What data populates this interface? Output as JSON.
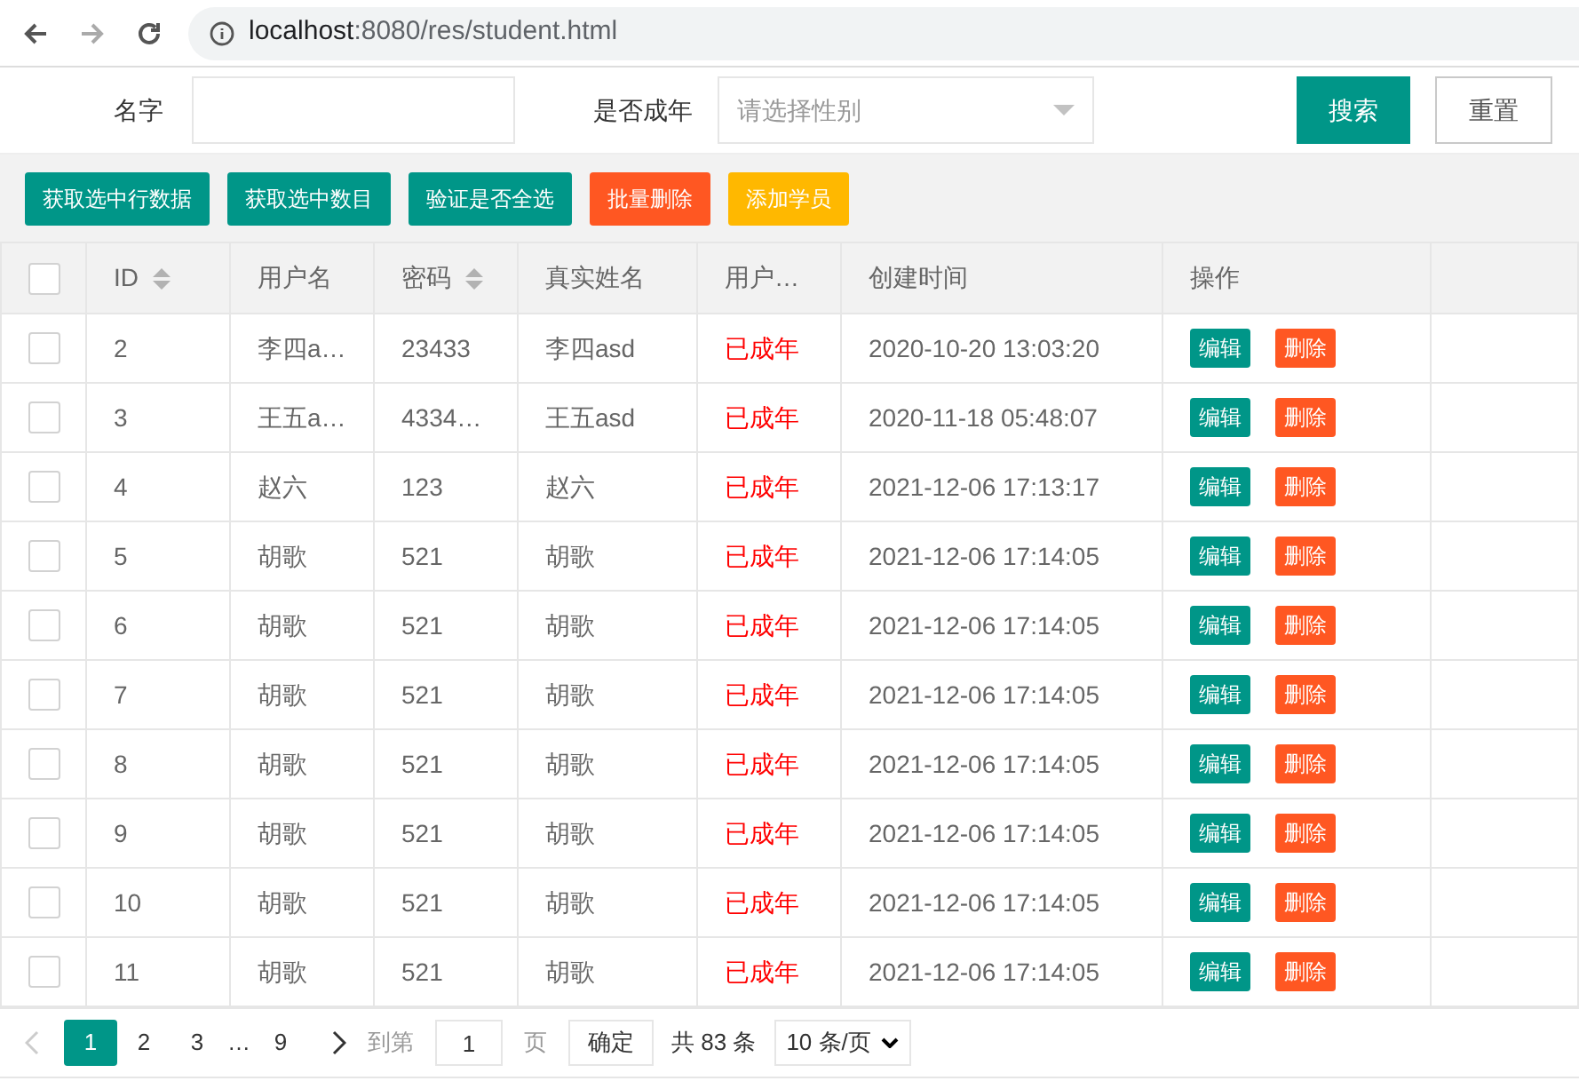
{
  "browser": {
    "url_host": "localhost",
    "url_rest": ":8080/res/student.html"
  },
  "search": {
    "name_label": "名字",
    "adult_label": "是否成年",
    "adult_placeholder": "请选择性别",
    "search_button": "搜索",
    "reset_button": "重置"
  },
  "toolbar": [
    {
      "label": "获取选中行数据",
      "kind": "primary"
    },
    {
      "label": "获取选中数目",
      "kind": "primary"
    },
    {
      "label": "验证是否全选",
      "kind": "primary"
    },
    {
      "label": "批量删除",
      "kind": "danger"
    },
    {
      "label": "添加学员",
      "kind": "warm"
    }
  ],
  "table": {
    "all_checked": false,
    "columns": [
      {
        "label": "ID",
        "sortable": true
      },
      {
        "label": "用户名",
        "sortable": false
      },
      {
        "label": "密码",
        "sortable": true
      },
      {
        "label": "真实姓名",
        "sortable": false
      },
      {
        "label": "用户…",
        "sortable": false
      },
      {
        "label": "创建时间",
        "sortable": false
      },
      {
        "label": "操作",
        "sortable": false
      }
    ],
    "rows": [
      {
        "checked": false,
        "cells": [
          "2",
          "李四a…",
          "23433",
          "李四asd",
          "已成年",
          "2020-10-20 13:03:20"
        ],
        "actions": [
          "编辑",
          "删除"
        ]
      },
      {
        "checked": false,
        "cells": [
          "3",
          "王五a…",
          "4334…",
          "王五asd",
          "已成年",
          "2020-11-18 05:48:07"
        ],
        "actions": [
          "编辑",
          "删除"
        ]
      },
      {
        "checked": false,
        "cells": [
          "4",
          "赵六",
          "123",
          "赵六",
          "已成年",
          "2021-12-06 17:13:17"
        ],
        "actions": [
          "编辑",
          "删除"
        ]
      },
      {
        "checked": false,
        "cells": [
          "5",
          "胡歌",
          "521",
          "胡歌",
          "已成年",
          "2021-12-06 17:14:05"
        ],
        "actions": [
          "编辑",
          "删除"
        ]
      },
      {
        "checked": false,
        "cells": [
          "6",
          "胡歌",
          "521",
          "胡歌",
          "已成年",
          "2021-12-06 17:14:05"
        ],
        "actions": [
          "编辑",
          "删除"
        ]
      },
      {
        "checked": false,
        "cells": [
          "7",
          "胡歌",
          "521",
          "胡歌",
          "已成年",
          "2021-12-06 17:14:05"
        ],
        "actions": [
          "编辑",
          "删除"
        ]
      },
      {
        "checked": false,
        "cells": [
          "8",
          "胡歌",
          "521",
          "胡歌",
          "已成年",
          "2021-12-06 17:14:05"
        ],
        "actions": [
          "编辑",
          "删除"
        ]
      },
      {
        "checked": false,
        "cells": [
          "9",
          "胡歌",
          "521",
          "胡歌",
          "已成年",
          "2021-12-06 17:14:05"
        ],
        "actions": [
          "编辑",
          "删除"
        ]
      },
      {
        "checked": false,
        "cells": [
          "10",
          "胡歌",
          "521",
          "胡歌",
          "已成年",
          "2021-12-06 17:14:05"
        ],
        "actions": [
          "编辑",
          "删除"
        ]
      },
      {
        "checked": false,
        "cells": [
          "11",
          "胡歌",
          "521",
          "胡歌",
          "已成年",
          "2021-12-06 17:14:05"
        ],
        "actions": [
          "编辑",
          "删除"
        ]
      }
    ]
  },
  "pagination": {
    "pages": [
      {
        "label": "1",
        "selected": true
      },
      {
        "label": "2",
        "selected": false
      },
      {
        "label": "3",
        "selected": false
      },
      {
        "label": "…",
        "kind": "ellipsis"
      },
      {
        "label": "9",
        "selected": false
      }
    ],
    "goto_label": "到第",
    "goto_value": "1",
    "page_label": "页",
    "confirm": "确定",
    "total": "共 83 条",
    "page_size": "10 条/页"
  }
}
